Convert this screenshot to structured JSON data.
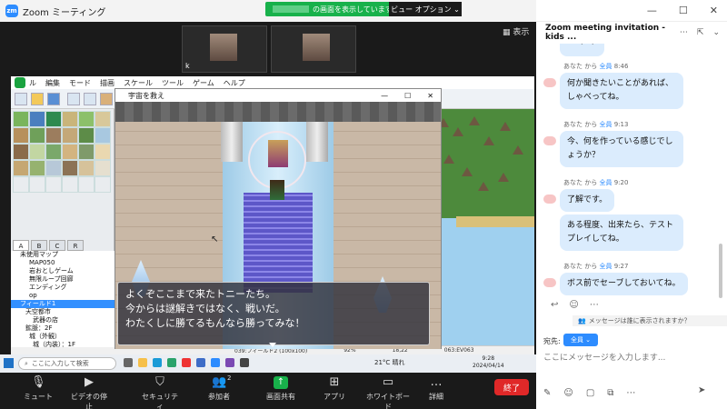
{
  "zoom": {
    "window_title": "Zoom ミーティング",
    "share_notice": "の画面を表示しています",
    "view_options": "ビュー オプション ⌄",
    "show_label": "▦ 表示",
    "participant_initial": "k"
  },
  "rpg": {
    "menu": [
      "ル",
      "編集",
      "モード",
      "描画",
      "スケール",
      "ツール",
      "ゲーム",
      "ヘルプ"
    ],
    "tabs": [
      "A",
      "B",
      "C",
      "R"
    ],
    "tree": [
      "未使用マップ",
      "MAP050",
      "岩おとしゲーム",
      "無限ループ回廊",
      "エンディング",
      "op",
      "フィールド1",
      "天空都市",
      "武器の店",
      "鉱脈：2F",
      "城（外観）",
      "城（内装）：1F"
    ],
    "status": [
      "039:フィールド2 (100x100)",
      "92%",
      "18,22",
      "063:EV063"
    ]
  },
  "game": {
    "window_title": "宇宙を救え",
    "dialog": [
      "よくぞここまで来たトニーたち。",
      "今からは謎解きではなく、戦いだ。",
      "わたくしに勝てるもんなら勝ってみな！"
    ]
  },
  "taskbar": {
    "search_placeholder": "ここに入力して検索",
    "weather": "21°C 晴れ",
    "time": "9:28",
    "date": "2024/04/14"
  },
  "controls": {
    "mute": "ミュート",
    "video": "ビデオの停止",
    "security": "セキュリティ",
    "participants": "参加者",
    "participants_count": "2",
    "share": "画面共有",
    "apps": "アプリ",
    "whiteboard": "ホワイトボード",
    "more": "詳細",
    "end": "終了"
  },
  "chat": {
    "title": "Zoom meeting invitation - kids ...",
    "messages": [
      {
        "meta_from": "あなた から",
        "meta_to": "全員",
        "time": "8:46",
        "text": "何か聞きたいことがあれば、しゃべってね。"
      },
      {
        "meta_from": "あなた から",
        "meta_to": "全員",
        "time": "9:13",
        "text": "今、何を作っている感じでしょうか？"
      },
      {
        "meta_from": "あなた から",
        "meta_to": "全員",
        "time": "9:20",
        "text": "了解です。"
      },
      {
        "meta_from": "",
        "meta_to": "",
        "time": "",
        "text": "ある程度、出来たら、テストプレイしてね。"
      },
      {
        "meta_from": "あなた から",
        "meta_to": "全員",
        "time": "9:27",
        "text": "ボス前でセーブしておいてね。"
      }
    ],
    "who_can_see": "メッセージは誰に表示されますか？",
    "to_label": "宛先:",
    "to_value": "全員 ⌄",
    "input_placeholder": "ここにメッセージを入力します..."
  },
  "colors": {
    "zoom_blue": "#2d8cff",
    "share_green": "#18b14b",
    "end_red": "#e02828",
    "bubble": "#dbecfd"
  }
}
